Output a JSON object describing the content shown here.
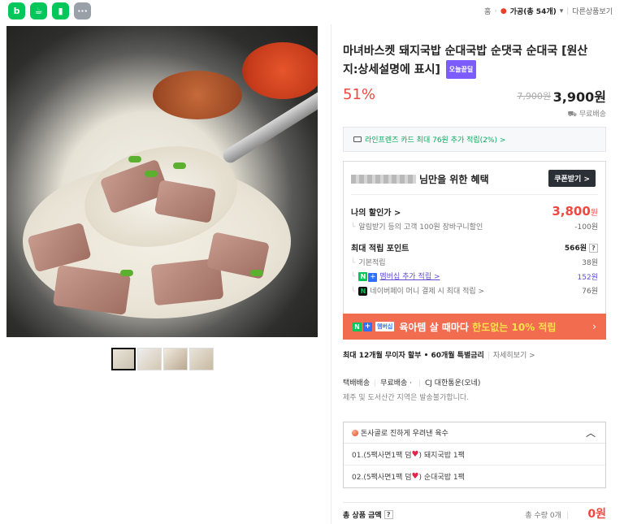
{
  "top_icons": [
    "blog-icon",
    "cafe-icon",
    "bookmark-icon",
    "more-icon"
  ],
  "breadcrumb": {
    "home": "홈",
    "category": "가공(총 54개)",
    "other": "다른상품보기"
  },
  "product": {
    "title": "마녀바스켓 돼지국밥 순대국밥 순댓국 순대국 [원산지:상세설명에 표시]",
    "badge": "오늘끝딜",
    "discount": "51%",
    "original_price": "7,900원",
    "price": "3,900원",
    "delivery": "무료배송"
  },
  "card_promo": "라인프렌즈 카드 최대 76원 추가 적립(2%) >",
  "benefit": {
    "title_suffix": "님만을 위한 혜택",
    "coupon_button": "쿠폰받기 >",
    "my_price_label": "나의 할인가 >",
    "my_price_value": "3,800",
    "my_price_unit": "원",
    "alarm_label": "알림받기 등의 고객 100원 장바구니할인",
    "alarm_value": "-100원",
    "points_label": "최대 적립 포인트",
    "points_value": "566원",
    "points_help": "?",
    "basic_label": "기본적립",
    "basic_value": "38원",
    "membership_label": "멤버십 추가 적립 >",
    "membership_value": "152원",
    "pay_label": "네이버페이 머니 결제 시 최대 적립 >",
    "pay_value": "76원"
  },
  "promo_banner": {
    "n": "N",
    "plus": "+",
    "membership": "멤버십",
    "text": "육아템 살 때마다 ",
    "highlight": "한도없는 10% 적립",
    "arrow": "›"
  },
  "installment": {
    "text": "최대 12개월 무이자 할부 • 60개월 특별금리",
    "more": "자세히보기 >"
  },
  "shipping": {
    "type": "택배배송",
    "fee": "무료배송",
    "carrier": "CJ 대한통운(오네)",
    "note": "제주 및 도서산간 지역은 발송불가합니다."
  },
  "options": {
    "header": "돈사골로 진하게 우려낸 육수",
    "caret": "︿",
    "items": [
      {
        "prefix": "01.(5팩사면1팩 덤",
        "suffix": ") 돼지국밥 1팩"
      },
      {
        "prefix": "02.(5팩사면1팩 덤",
        "suffix": ") 순대국밥 1팩"
      }
    ]
  },
  "total": {
    "label": "총 상품 금액",
    "help": "?",
    "qty": "총 수량 0개",
    "price": "0원"
  },
  "colors": {
    "naver_green": "#03c75a",
    "sale_red": "#f2473f",
    "promo_orange": "#f26c4f",
    "membership_purple": "#5f4bd8"
  }
}
